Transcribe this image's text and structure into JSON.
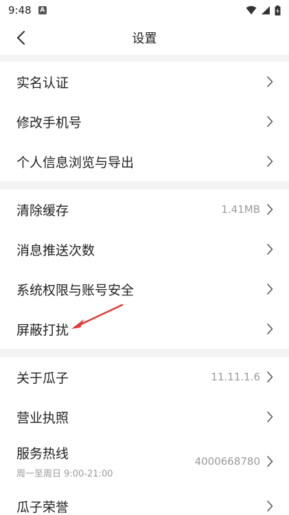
{
  "status": {
    "time": "9:48",
    "badge": "A"
  },
  "nav": {
    "title": "设置"
  },
  "groups": [
    {
      "items": [
        {
          "label": "实名认证"
        },
        {
          "label": "修改手机号"
        },
        {
          "label": "个人信息浏览与导出"
        }
      ]
    },
    {
      "items": [
        {
          "label": "清除缓存",
          "value": "1.41MB"
        },
        {
          "label": "消息推送次数"
        },
        {
          "label": "系统权限与账号安全"
        },
        {
          "label": "屏蔽打扰"
        }
      ]
    },
    {
      "items": [
        {
          "label": "关于瓜子",
          "value": "11.11.1.6"
        },
        {
          "label": "营业执照"
        },
        {
          "label": "服务热线",
          "value": "4000668780",
          "sub": "周一至周日 9:00-21:00"
        },
        {
          "label": "瓜子荣誉"
        }
      ]
    }
  ],
  "colors": {
    "annotation": "#e53935",
    "divider_band": "#f3f3f3"
  }
}
